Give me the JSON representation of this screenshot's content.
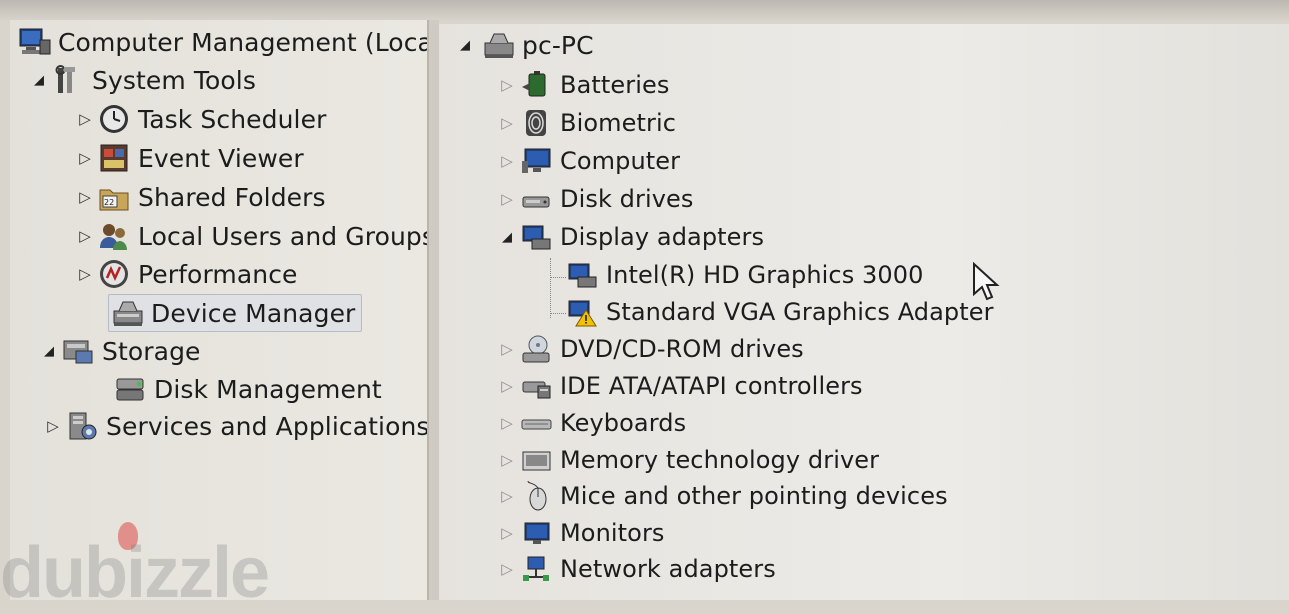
{
  "left_tree": {
    "root": "Computer Management (Local",
    "system_tools": "System Tools",
    "task_scheduler": "Task Scheduler",
    "event_viewer": "Event Viewer",
    "shared_folders": "Shared Folders",
    "local_users": "Local Users and Groups",
    "performance": "Performance",
    "device_manager": "Device Manager",
    "storage": "Storage",
    "disk_management": "Disk Management",
    "services": "Services and Applications"
  },
  "right_tree": {
    "computer": "pc-PC",
    "batteries": "Batteries",
    "biometric": "Biometric",
    "computer_cat": "Computer",
    "disk_drives": "Disk drives",
    "display_adapters": "Display adapters",
    "intel_hd": "Intel(R) HD Graphics 3000",
    "standard_vga": "Standard VGA Graphics Adapter",
    "dvd": "DVD/CD-ROM drives",
    "ide": "IDE ATA/ATAPI controllers",
    "keyboards": "Keyboards",
    "memory": "Memory technology driver",
    "mice": "Mice and other pointing devices",
    "monitors": "Monitors",
    "network": "Network adapters"
  },
  "watermark": "dubizzle",
  "colors": {
    "selection": "#dfe1e5",
    "background": "#e6e3de",
    "warning": "#f2c200"
  }
}
